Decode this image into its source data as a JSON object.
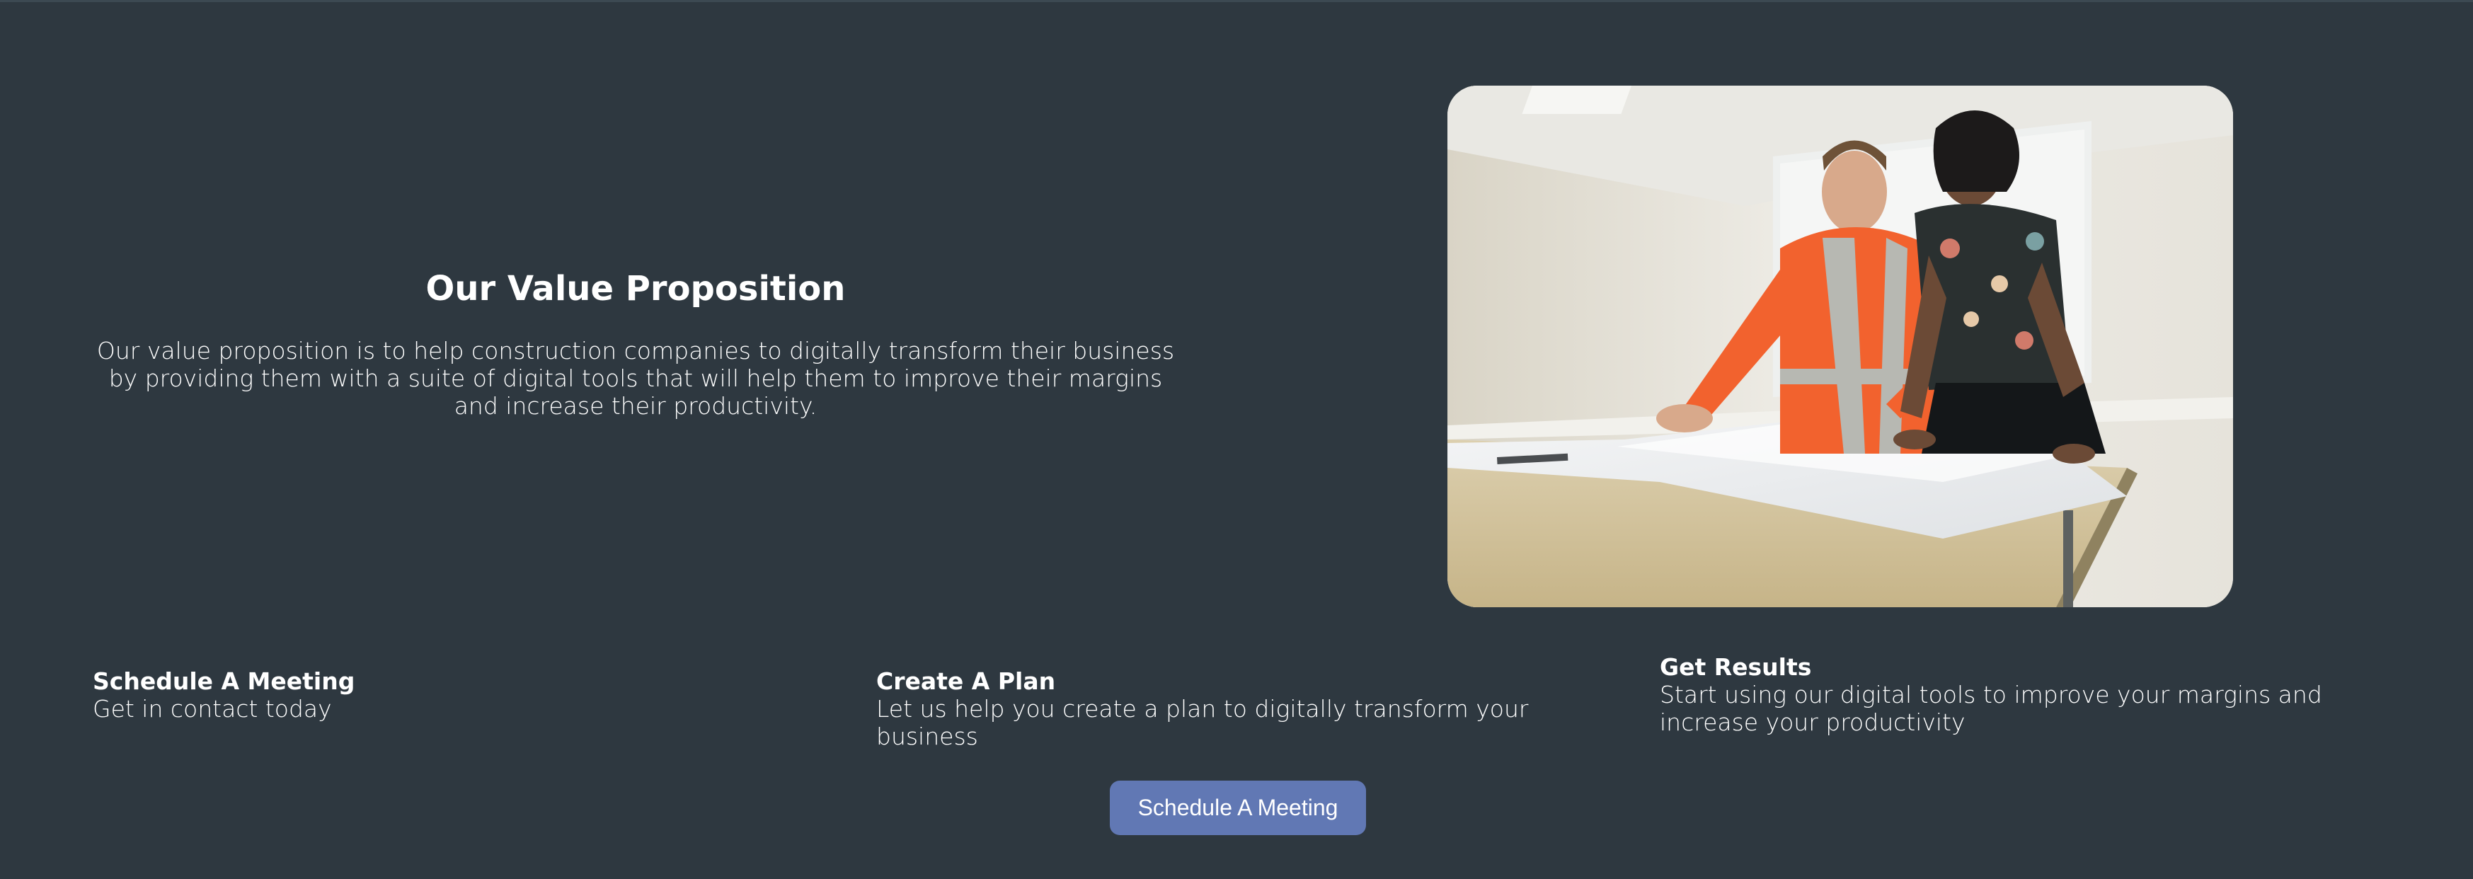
{
  "hero": {
    "title": "Our Value Proposition",
    "description": "Our value proposition is to help construction companies to digitally transform their business by providing them with a suite of digital tools that will help them to improve their margins and increase their productivity.",
    "image_subject": "two-people-reviewing-blueprints-photo"
  },
  "features": [
    {
      "title": "Schedule A Meeting",
      "text": "Get in contact today"
    },
    {
      "title": "Create A Plan",
      "text": "Let us help you create a plan to digitally transform your business"
    },
    {
      "title": "Get Results",
      "text": "Start using our digital tools to improve your margins and increase your productivity"
    }
  ],
  "cta": {
    "label": "Schedule A Meeting"
  },
  "colors": {
    "background": "#2e3840",
    "button": "#6178b4",
    "text": "#ffffff"
  }
}
